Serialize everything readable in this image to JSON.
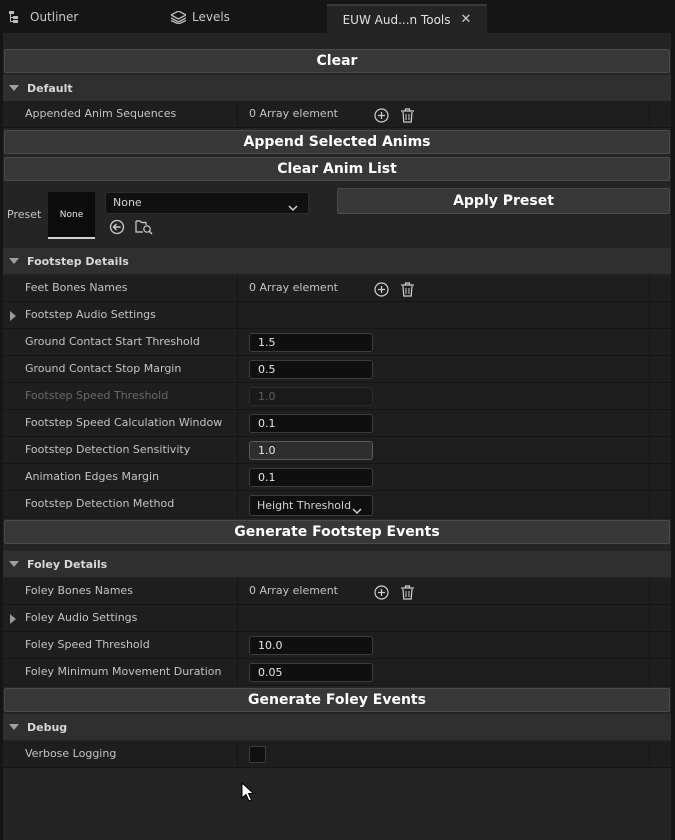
{
  "tabs": [
    {
      "label": "Outliner",
      "icon": "outliner-icon"
    },
    {
      "label": "Levels",
      "icon": "levels-icon"
    },
    {
      "label": "EUW Aud...n Tools",
      "icon": "close-icon"
    }
  ],
  "buttons": {
    "clear": "Clear",
    "append_selected": "Append Selected Anims",
    "clear_anim_list": "Clear Anim List",
    "apply_preset": "Apply Preset",
    "generate_footstep": "Generate Footstep Events",
    "generate_foley": "Generate Foley Events"
  },
  "default_section": {
    "title": "Default",
    "appended_label": "Appended Anim Sequences",
    "appended_value": "0 Array element"
  },
  "preset": {
    "label": "Preset",
    "thumbnail_text": "None",
    "selected": "None"
  },
  "footstep": {
    "title": "Footstep Details",
    "feet_bones_label": "Feet Bones Names",
    "feet_bones_value": "0 Array element",
    "audio_settings_label": "Footstep Audio Settings",
    "ground_start_label": "Ground Contact Start Threshold",
    "ground_start_value": "1.5",
    "ground_stop_label": "Ground Contact Stop Margin",
    "ground_stop_value": "0.5",
    "speed_threshold_label": "Footstep Speed Threshold",
    "speed_threshold_value": "1.0",
    "speed_window_label": "Footstep Speed Calculation Window",
    "speed_window_value": "0.1",
    "sensitivity_label": "Footstep Detection Sensitivity",
    "sensitivity_value": "1.0",
    "edges_label": "Animation Edges Margin",
    "edges_value": "0.1",
    "method_label": "Footstep Detection Method",
    "method_value": "Height Threshold"
  },
  "foley": {
    "title": "Foley Details",
    "bones_label": "Foley Bones Names",
    "bones_value": "0 Array element",
    "audio_settings_label": "Foley Audio Settings",
    "speed_threshold_label": "Foley Speed Threshold",
    "speed_threshold_value": "10.0",
    "min_duration_label": "Foley Minimum Movement Duration",
    "min_duration_value": "0.05"
  },
  "debug": {
    "title": "Debug",
    "verbose_label": "Verbose Logging",
    "verbose_checked": false
  },
  "colors": {
    "panel_bg": "#242424",
    "row_bg": "#1e1e1e",
    "section_bg": "#2f2f2f",
    "button_bg": "#383838",
    "input_bg": "#0f0f0f"
  }
}
